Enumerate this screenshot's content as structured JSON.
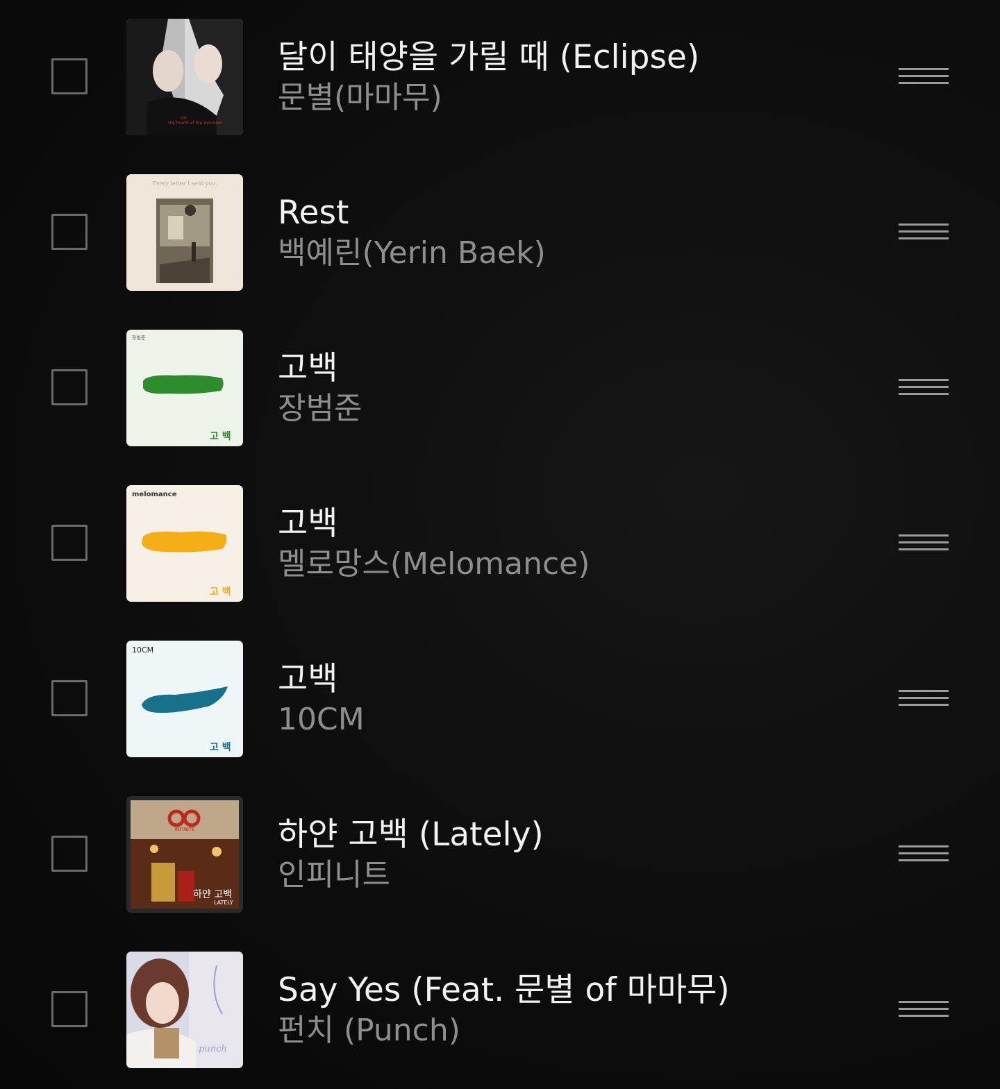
{
  "playlist": {
    "items": [
      {
        "title": "달이 태양을 가릴 때 (Eclipse)",
        "artist": "문별(마마무)",
        "art_icon": "album-art-eclipse"
      },
      {
        "title": "Rest",
        "artist": "백예린(Yerin Baek)",
        "art_icon": "album-art-every-letter",
        "art_text": "Every letter I sent you."
      },
      {
        "title": "고백",
        "artist": "장범준",
        "art_icon": "album-art-gobaek-green",
        "art_brand": "장범준",
        "art_text": "고 백"
      },
      {
        "title": "고백",
        "artist": "멜로망스(Melomance)",
        "art_icon": "album-art-gobaek-yellow",
        "art_brand": "melomance",
        "art_text": "고 백"
      },
      {
        "title": "고백",
        "artist": "10CM",
        "art_icon": "album-art-gobaek-teal",
        "art_brand": "10CM",
        "art_text": "고 백"
      },
      {
        "title": "하얀 고백 (Lately)",
        "artist": "인피니트",
        "art_icon": "album-art-infinite",
        "art_brand": "INFINITE",
        "art_text": "하얀 고백",
        "art_subtext": "LATELY"
      },
      {
        "title": "Say Yes (Feat. 문별 of 마마무)",
        "artist": "펀치 (Punch)",
        "art_icon": "album-art-punch",
        "art_text": "punch"
      }
    ]
  },
  "colors": {
    "background": "#0c0c0c",
    "title_text": "#f2f2f2",
    "artist_text": "#8e8e8e",
    "checkbox_border": "#6a6a6a",
    "handle": "#9c9c9c"
  }
}
